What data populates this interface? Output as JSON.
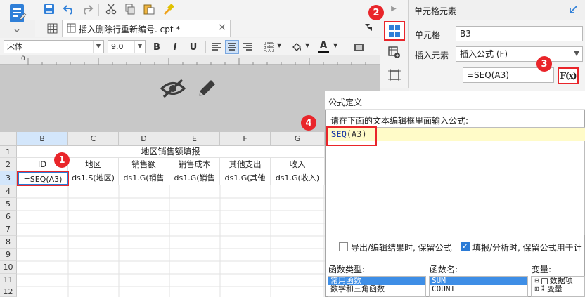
{
  "toolbar": {
    "tab_title": "插入删除行重新编号. cpt *",
    "font_name": "宋体",
    "font_size": "9.0",
    "bold": "B",
    "italic": "I",
    "underline": "U",
    "text_color_letter": "A"
  },
  "ruler": {
    "origin": "0"
  },
  "sheet": {
    "columns": [
      "B",
      "C",
      "D",
      "E",
      "F",
      "G"
    ],
    "rows": [
      "1",
      "2",
      "3",
      "4",
      "5",
      "6",
      "7",
      "8",
      "9",
      "10",
      "11",
      "12"
    ],
    "title": "地区销售额填报",
    "headers": [
      "ID",
      "地区",
      "销售额",
      "销售成本",
      "其他支出",
      "收入"
    ],
    "data_row": [
      "=SEQ(A3)",
      "ds1.S(地区)",
      "ds1.G(销售",
      "ds1.G(销售",
      "ds1.G(其他",
      "ds1.G(收入)"
    ]
  },
  "badges": [
    "1",
    "2",
    "3",
    "4"
  ],
  "panel": {
    "title": "单元格元素",
    "cell_label": "单元格",
    "cell_value": "B3",
    "insert_label": "插入元素",
    "insert_value": "插入公式 (F)",
    "formula_value": "=SEQ(A3)",
    "formula_button": "F(x)"
  },
  "dialog": {
    "title": "公式定义",
    "prompt": "请在下面的文本编辑框里面输入公式:",
    "formula_func": "SEQ",
    "formula_arg": "(A3)",
    "option_export": "导出/编辑结果时, 保留公式",
    "option_fill": "填报/分析时, 保留公式用于计",
    "func_type_label": "函数类型:",
    "func_name_label": "函数名:",
    "var_label": "变量:",
    "func_types": [
      "常用函数",
      "数学和三角函数"
    ],
    "func_names": [
      "SUM",
      "COUNT"
    ],
    "variables": [
      "数据项",
      "变量"
    ]
  },
  "colors": {
    "badge": "#e9252a",
    "selection": "#2b7bd6",
    "highlight": "#fffbc8",
    "formula_keyword": "#1f3da6"
  }
}
